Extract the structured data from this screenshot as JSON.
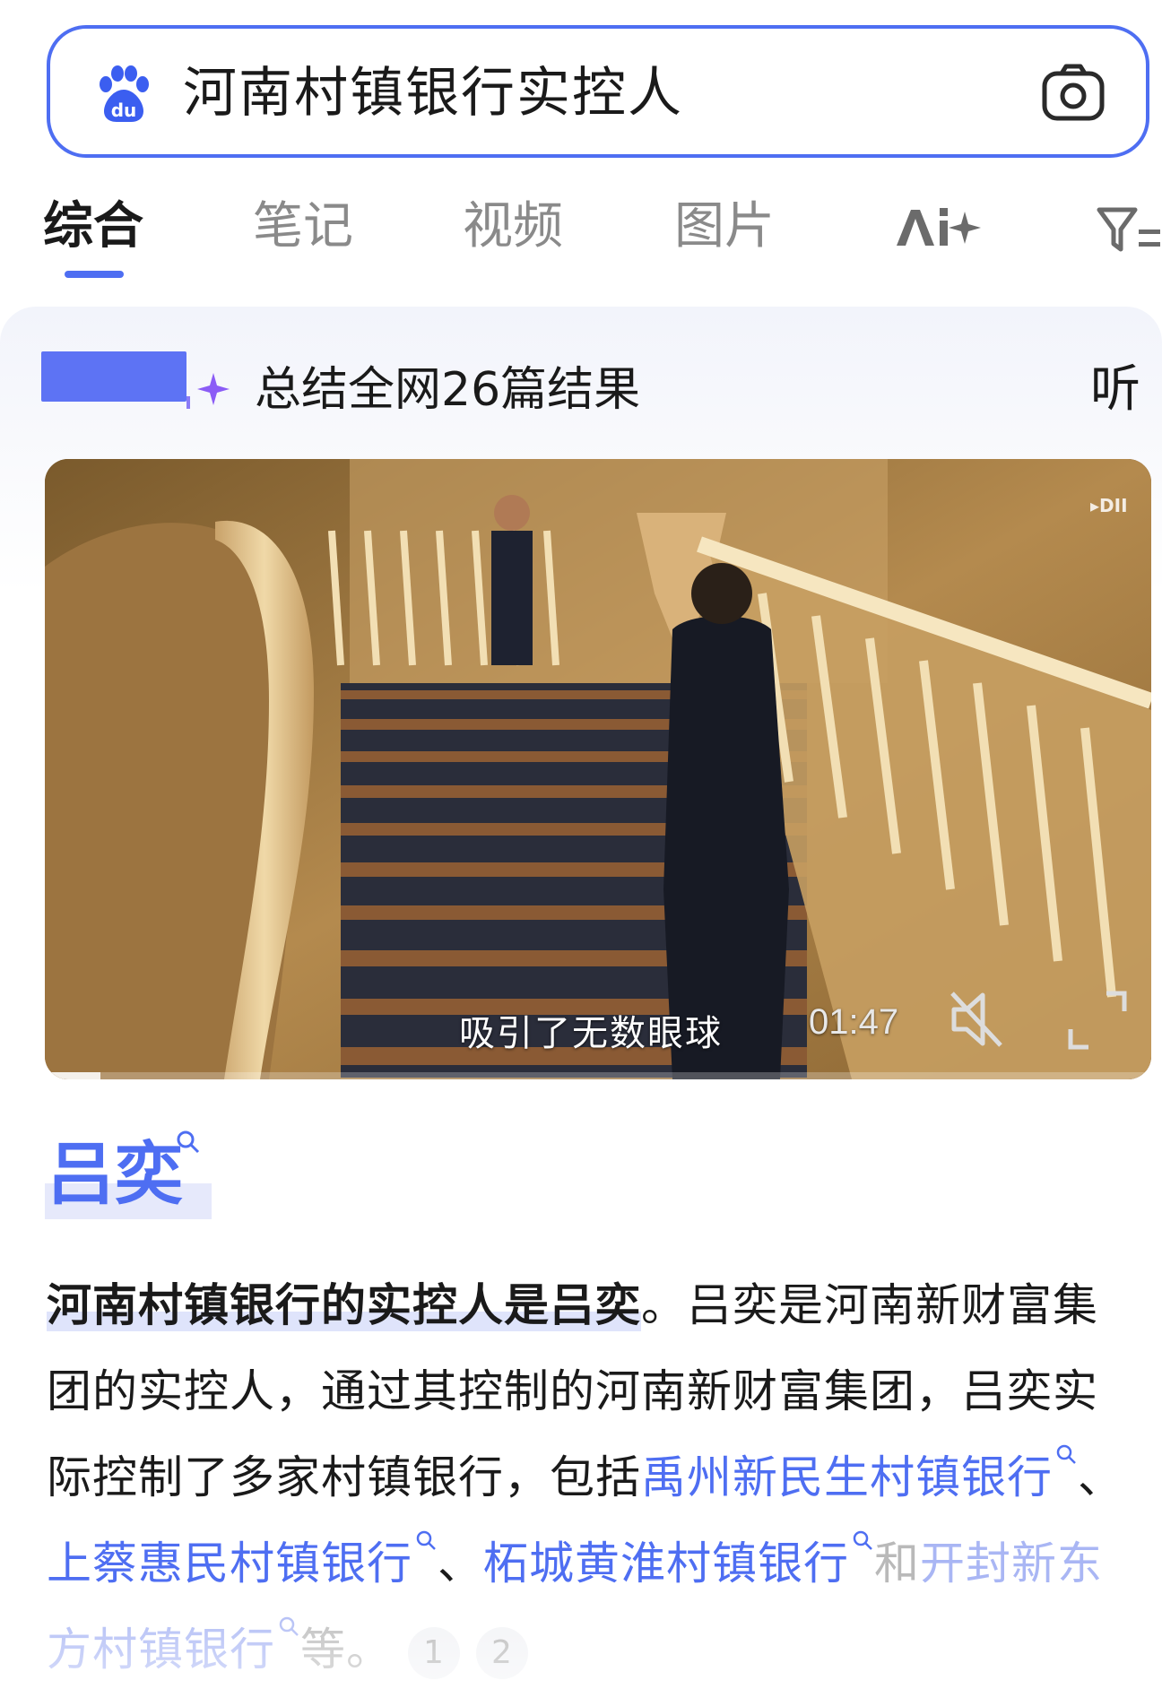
{
  "search": {
    "query": "河南村镇银行实控人"
  },
  "tabs": [
    {
      "label": "综合"
    },
    {
      "label": "笔记"
    },
    {
      "label": "视频"
    },
    {
      "label": "图片"
    }
  ],
  "summary": {
    "text": "总结全网26篇结果",
    "listen_label": "听"
  },
  "video": {
    "subtitle": "吸引了无数眼球",
    "duration": "01:47",
    "progress": 0.05
  },
  "answer": {
    "title": "吕奕",
    "highlight": "河南村镇银行的实控人是吕奕",
    "after_highlight": "。吕奕是河南新财富集团的实控人，通过其控制的河南新财富集团，吕奕实际控制了多家村镇银行，包括",
    "links": [
      "禹州新民生村镇银行",
      "上蔡惠民村镇银行",
      "柘城黄淮村镇银行",
      "开封新东方村镇银行"
    ],
    "sep1": "、",
    "sep2": "、",
    "connector": "和",
    "ending": "等。",
    "citations": [
      "1",
      "2"
    ]
  },
  "colors": {
    "accent": "#4e6ef2",
    "text": "#1a1a1a",
    "muted": "#8a8a8a"
  },
  "icons": [
    "baidu-logo-icon",
    "camera-icon",
    "ai-plus-icon",
    "filter-icon",
    "sparkle-icon",
    "mute-icon",
    "fullscreen-icon",
    "search-small-icon"
  ]
}
